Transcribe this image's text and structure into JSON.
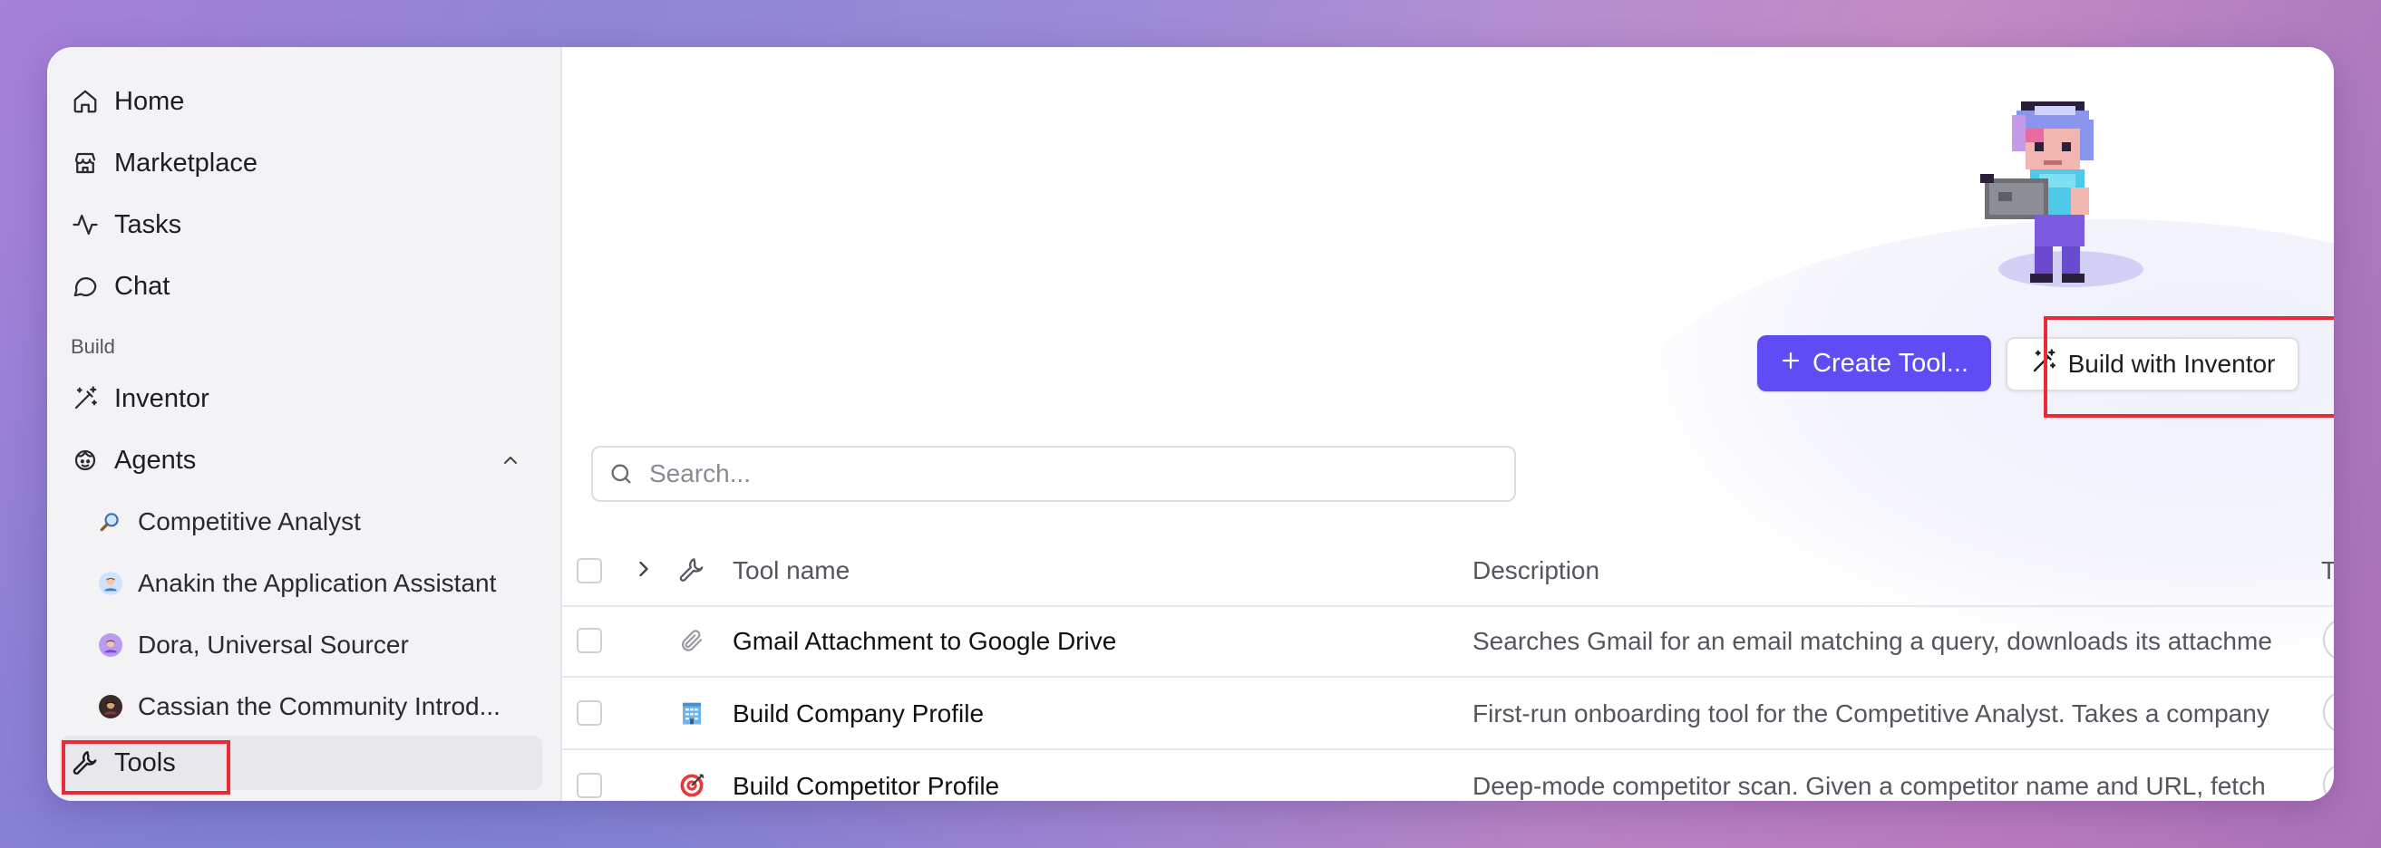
{
  "sidebar": {
    "items": [
      {
        "label": "Home",
        "icon": "home-icon"
      },
      {
        "label": "Marketplace",
        "icon": "store-icon"
      },
      {
        "label": "Tasks",
        "icon": "activity-icon"
      },
      {
        "label": "Chat",
        "icon": "chat-icon"
      }
    ],
    "section_build": "Build",
    "inventor": {
      "label": "Inventor",
      "icon": "wand-icon"
    },
    "agents": {
      "label": "Agents",
      "icon": "agent-icon",
      "expanded": true
    },
    "agent_items": [
      {
        "label": "Competitive Analyst",
        "icon": "magnifier-emoji"
      },
      {
        "label": "Anakin the Application Assistant",
        "icon": "avatar-blue"
      },
      {
        "label": "Dora, Universal Sourcer",
        "icon": "avatar-purple"
      },
      {
        "label": "Cassian the Community Introd...",
        "icon": "avatar-dark"
      }
    ],
    "tools": {
      "label": "Tools",
      "icon": "wrench-icon",
      "active": true
    }
  },
  "header": {
    "create_tool_label": "Create Tool...",
    "build_with_inventor_label": "Build with Inventor"
  },
  "search": {
    "placeholder": "Search..."
  },
  "table": {
    "columns": {
      "name": "Tool name",
      "description": "Description",
      "type": "Type"
    },
    "rows": [
      {
        "name": "Gmail Attachment to Google Drive",
        "icon": "paperclip-icon",
        "description": "Searches Gmail for an email matching a query, downloads its attachme"
      },
      {
        "name": "Build Company Profile",
        "icon": "office-building-emoji",
        "description": "First-run onboarding tool for the Competitive Analyst. Takes a company"
      },
      {
        "name": "Build Competitor Profile",
        "icon": "target-emoji",
        "description": "Deep-mode competitor scan. Given a competitor name and URL, fetch"
      }
    ]
  },
  "colors": {
    "accent": "#5f4cf5",
    "highlight": "#ea2a34"
  }
}
